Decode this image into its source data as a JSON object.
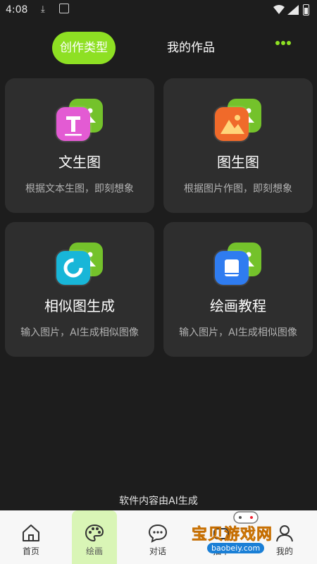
{
  "status_bar": {
    "time": "4:08"
  },
  "tabs": {
    "active": "创作类型",
    "other": "我的作品"
  },
  "cards": [
    {
      "title": "文生图",
      "subtitle": "根据文本生图，即刻想象",
      "icon": "text-t-icon",
      "color": "#e35bd3"
    },
    {
      "title": "图生图",
      "subtitle": "根据图片作图，即刻想象",
      "icon": "image-icon",
      "color": "#f06a2a"
    },
    {
      "title": "相似图生成",
      "subtitle": "输入图片，AI生成相似图像",
      "icon": "circle-refresh-icon",
      "color": "#18b6d8"
    },
    {
      "title": "绘画教程",
      "subtitle": "输入图片，AI生成相似图像",
      "icon": "book-icon",
      "color": "#2f7cf0"
    }
  ],
  "footer_note": "软件内容由AI生成",
  "nav": [
    {
      "label": "首页",
      "icon": "home-icon"
    },
    {
      "label": "绘画",
      "icon": "palette-icon",
      "active": true
    },
    {
      "label": "对话",
      "icon": "chat-icon"
    },
    {
      "label": "抽甲",
      "icon": "game-icon"
    },
    {
      "label": "我的",
      "icon": "user-icon"
    }
  ],
  "watermark": {
    "text": "宝贝游戏网",
    "url": "baobeiy.com"
  },
  "colors": {
    "accent": "#8ee023",
    "background": "#1d1d1d",
    "card": "#2e2e2e"
  }
}
